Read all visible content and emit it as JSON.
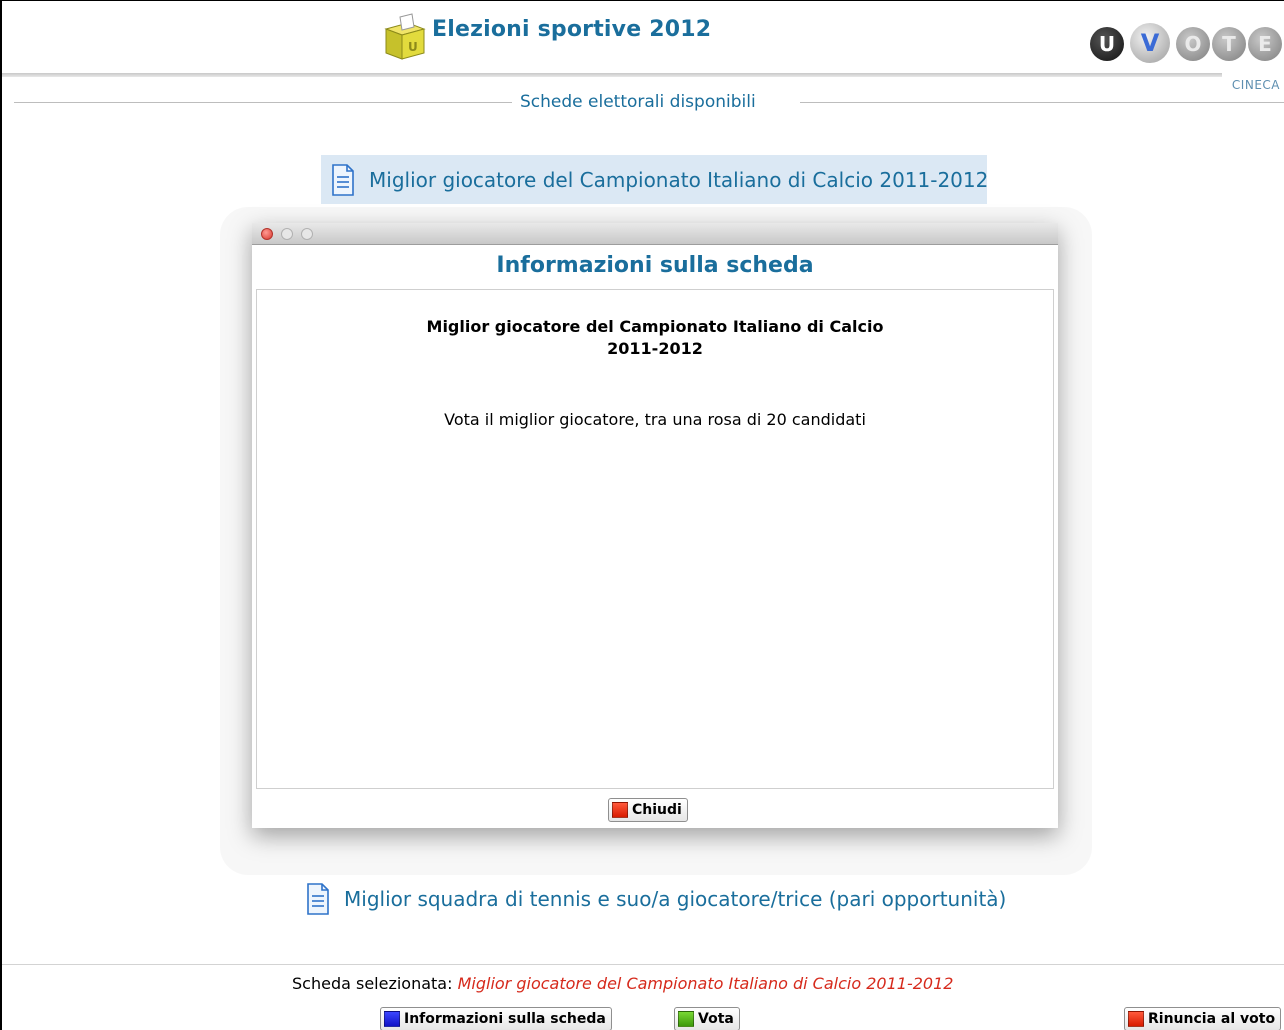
{
  "header": {
    "title": "Elezioni sportive 2012",
    "logo_icon": "ballot-box-icon",
    "brand_letters": [
      "U",
      "V",
      "O",
      "T",
      "E"
    ],
    "brand_subtitle": "CINECA"
  },
  "section": {
    "title": "Schede elettorali disponibili"
  },
  "ballots": [
    {
      "label": "Miglior giocatore del Campionato Italiano di Calcio 2011-2012",
      "icon": "document-icon",
      "selected": true
    },
    {
      "label": "Miglior squadra di tennis e suo/a giocatore/trice (pari opportunità)",
      "icon": "document-icon",
      "selected": false
    }
  ],
  "modal": {
    "heading": "Informazioni sulla scheda",
    "ballot_title": "Miglior giocatore del Campionato Italiano di Calcio\n2011-2012",
    "description": "Vota il miglior giocatore, tra una rosa di 20 candidati",
    "close_label": "Chiudi"
  },
  "footer": {
    "selected_label": "Scheda selezionata:",
    "selected_value": "Miglior giocatore del Campionato Italiano di Calcio 2011-2012",
    "info_button": "Informazioni sulla scheda",
    "vote_button": "Vota",
    "renounce_button": "Rinuncia al voto"
  },
  "colors": {
    "accent": "#1a6e9c",
    "selected_text": "#d62a1c",
    "selected_bg": "#dbe8f4"
  }
}
